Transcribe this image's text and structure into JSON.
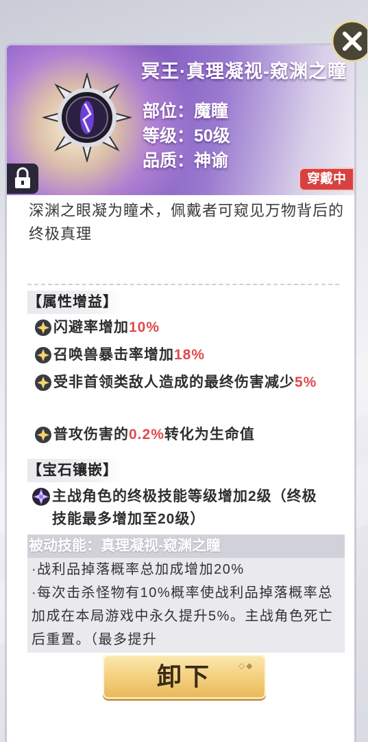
{
  "item": {
    "title": "冥王·真理凝视-窥渊之瞳",
    "slot": "部位：魔瞳",
    "level": "等级：50级",
    "quality": "品质：神谕",
    "status_badge": "穿戴中",
    "description": "深渊之眼凝为瞳术，佩戴者可窥见万物背后的终极真理"
  },
  "attributes": {
    "header": "【属性增益】",
    "bonuses": [
      {
        "text": "闪避率增加",
        "value": "10%"
      },
      {
        "text": "召唤兽暴击率增加",
        "value": "18%"
      },
      {
        "text": "受非首领类敌人造成的最终伤害减少",
        "value": "5%"
      },
      {
        "text": "普攻伤害的",
        "value": "0.2%",
        "suffix": "转化为生命值"
      }
    ]
  },
  "gem": {
    "header": "【宝石镶嵌】",
    "text": "主战角色的终极技能等级增加2级（终极技能最多增加至20级）"
  },
  "passive": {
    "header": "被动技能：真理凝视-窥渊之瞳",
    "lines": [
      "·战利品掉落概率总加成增加20%",
      "·每次击杀怪物有10%概率使战利品掉落概率总加成在本局游戏中永久提升5%。主战角色死亡后重置。（最多提升"
    ]
  },
  "actions": {
    "unequip_label": "卸下"
  },
  "icons": {
    "close": "close-icon",
    "lock": "lock-icon",
    "bonus_bullet": "star-badge-icon",
    "gem": "gem-icon",
    "emblem": "dark-eye-emblem-icon"
  },
  "colors": {
    "highlight_red": "#e0494c",
    "badge_red": "#d7413f",
    "header_purple": "#8c63c9",
    "button_gold": "#f4d07f"
  }
}
